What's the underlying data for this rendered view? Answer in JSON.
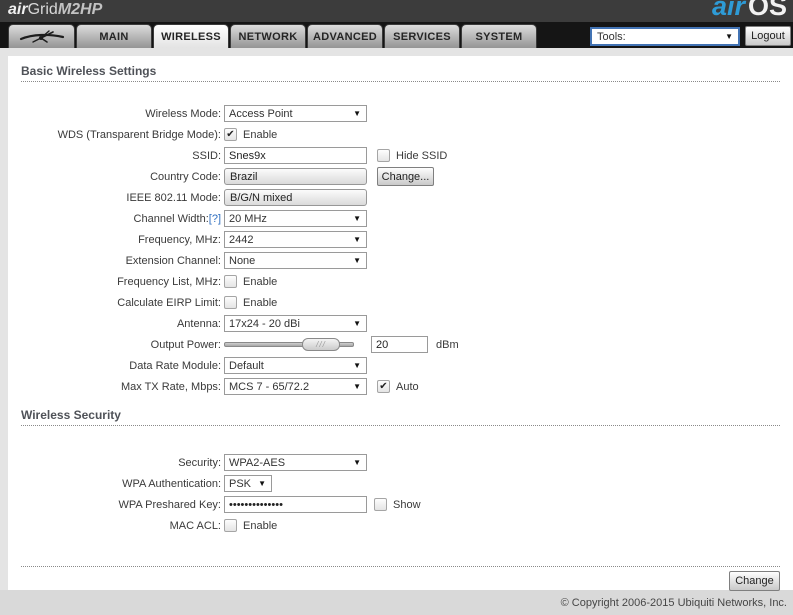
{
  "ui": {
    "select_arrow": "▼",
    "check_glyph": "✔",
    "slider_hatch": "///"
  },
  "header": {
    "brand_air": "air",
    "brand_grid": "Grid",
    "brand_model": "M2HP",
    "airos_air": "air",
    "airos_os": "OS",
    "tools_label": "Tools:",
    "logout_label": "Logout"
  },
  "tabs": [
    {
      "label": "",
      "icon": "ubiquiti-logo"
    },
    {
      "label": "MAIN"
    },
    {
      "label": "WIRELESS",
      "active": true
    },
    {
      "label": "NETWORK"
    },
    {
      "label": "ADVANCED"
    },
    {
      "label": "SERVICES"
    },
    {
      "label": "SYSTEM"
    }
  ],
  "basic": {
    "title": "Basic Wireless Settings",
    "wireless_mode": {
      "label": "Wireless Mode:",
      "value": "Access Point"
    },
    "wds": {
      "label": "WDS (Transparent Bridge Mode):",
      "checkbox_label": "Enable",
      "checked": true
    },
    "ssid": {
      "label": "SSID:",
      "value": "Snes9x",
      "hide_label": "Hide SSID",
      "hide_checked": false
    },
    "country": {
      "label": "Country Code:",
      "value": "Brazil",
      "button_label": "Change..."
    },
    "ieee_mode": {
      "label": "IEEE 802.11 Mode:",
      "value": "B/G/N mixed"
    },
    "channel_width": {
      "label": "Channel Width:",
      "help": "[?]",
      "value": "20 MHz"
    },
    "frequency": {
      "label": "Frequency, MHz:",
      "value": "2442"
    },
    "extension_channel": {
      "label": "Extension Channel:",
      "value": "None"
    },
    "frequency_list": {
      "label": "Frequency List, MHz:",
      "checkbox_label": "Enable",
      "checked": false
    },
    "eirp_limit": {
      "label": "Calculate EIRP Limit:",
      "checkbox_label": "Enable",
      "checked": false
    },
    "antenna": {
      "label": "Antenna:",
      "value": "17x24 - 20 dBi"
    },
    "output_power": {
      "label": "Output Power:",
      "value": "20",
      "unit": "dBm",
      "slider_percent": 75
    },
    "data_rate_module": {
      "label": "Data Rate Module:",
      "value": "Default"
    },
    "max_tx_rate": {
      "label": "Max TX Rate, Mbps:",
      "value": "MCS 7 - 65/72.2",
      "auto_label": "Auto",
      "auto_checked": true
    }
  },
  "security": {
    "title": "Wireless Security",
    "security": {
      "label": "Security:",
      "value": "WPA2-AES"
    },
    "wpa_authentication": {
      "label": "WPA Authentication:",
      "value": "PSK"
    },
    "wpa_preshared_key": {
      "label": "WPA Preshared Key:",
      "value": "••••••••••••••",
      "show_label": "Show",
      "show_checked": false
    },
    "mac_acl": {
      "label": "MAC ACL:",
      "checkbox_label": "Enable",
      "checked": false
    }
  },
  "footer": {
    "change_label": "Change",
    "copyright": "© Copyright 2006-2015 Ubiquiti Networks, Inc."
  }
}
